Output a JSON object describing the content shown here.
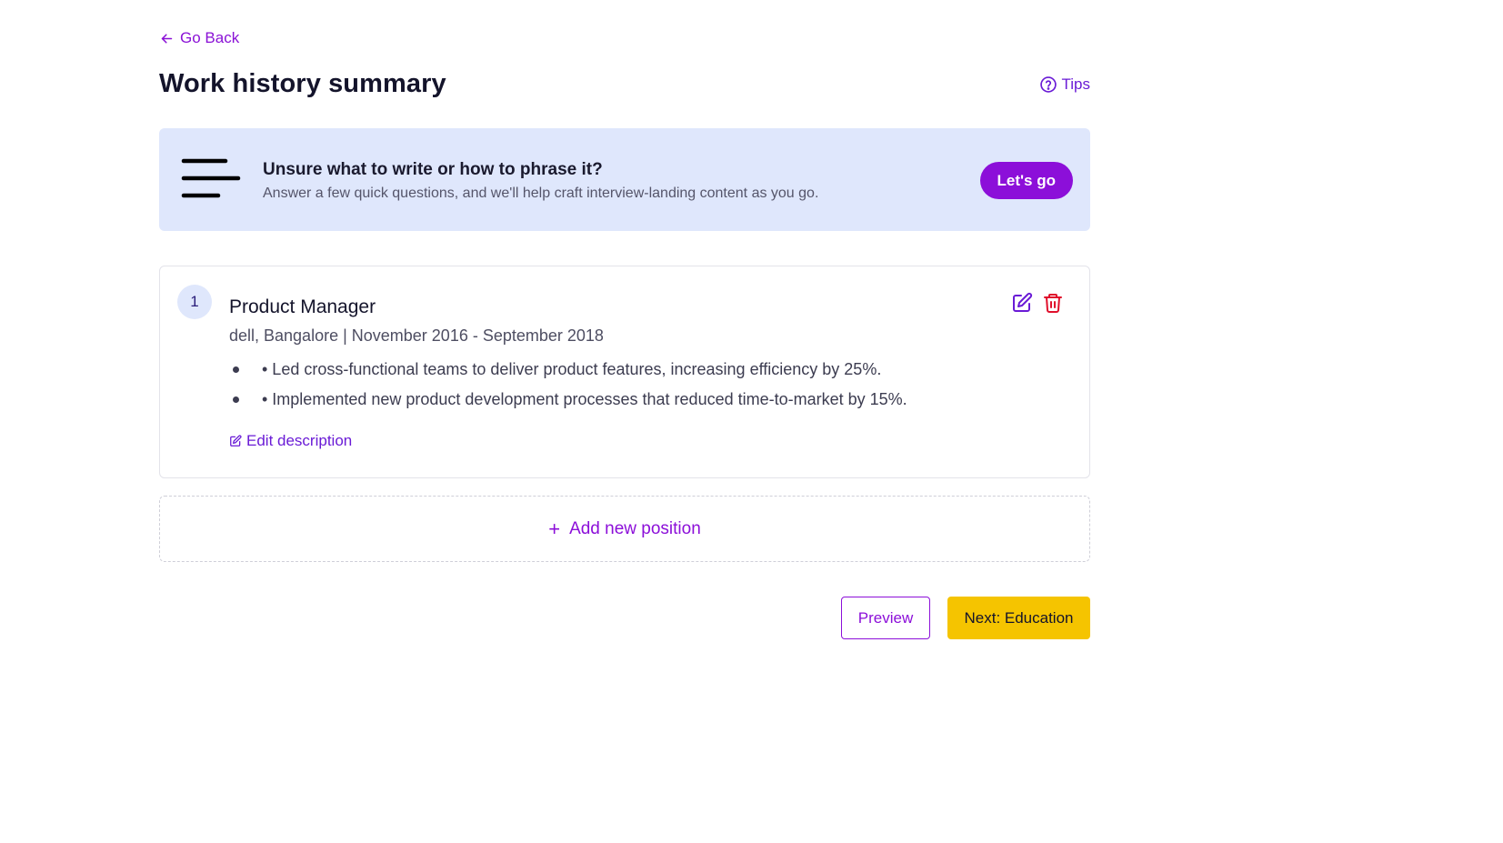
{
  "nav": {
    "back_label": "Go Back"
  },
  "header": {
    "title": "Work history summary",
    "tips_label": "Tips"
  },
  "banner": {
    "heading": "Unsure what to write or how to phrase it?",
    "subtext": "Answer a few quick questions, and we'll help craft interview-landing content as you go.",
    "cta_label": "Let's go"
  },
  "positions": [
    {
      "index": "1",
      "title": "Product Manager",
      "meta": "dell, Bangalore | November 2016 - September 2018",
      "bullets": [
        "• Led cross-functional teams to deliver product features, increasing efficiency by 25%.",
        "• Implemented new product development processes that reduced time-to-market by 15%."
      ],
      "edit_description_label": "Edit description"
    }
  ],
  "add_position": {
    "plus": "+",
    "label": "Add new position"
  },
  "footer": {
    "preview_label": "Preview",
    "next_label": "Next: Education"
  },
  "colors": {
    "accent_purple": "#8c0fd9",
    "link_violet": "#6a1bd6",
    "banner_bg": "#dfe7fc",
    "next_button": "#f5c400",
    "delete_red": "#e0102c"
  },
  "icons": {
    "back": "arrow-left-icon",
    "tips": "question-circle-icon",
    "banner": "menu-lines-icon",
    "edit": "pencil-square-icon",
    "delete": "trash-icon"
  }
}
